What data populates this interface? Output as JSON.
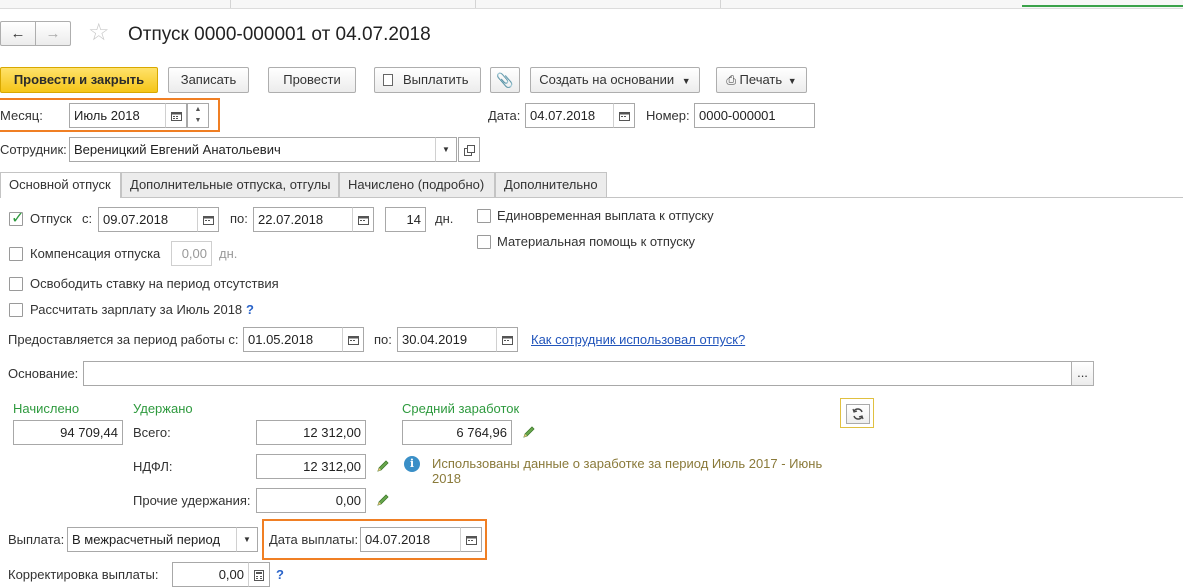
{
  "window": {
    "title": "Отпуск 0000-000001 от 04.07.2018"
  },
  "toolbar": {
    "post_and_close": "Провести и закрыть",
    "save": "Записать",
    "post": "Провести",
    "pay": "Выплатить",
    "create_based_on": "Создать на основании",
    "print": "Печать"
  },
  "header": {
    "month_label": "Месяц:",
    "month_value": "Июль 2018",
    "date_label": "Дата:",
    "date_value": "04.07.2018",
    "number_label": "Номер:",
    "number_value": "0000-000001",
    "employee_label": "Сотрудник:",
    "employee_value": "Вереницкий Евгений Анатольевич"
  },
  "tabs": [
    {
      "label": "Основной отпуск",
      "active": true
    },
    {
      "label": "Дополнительные отпуска, отгулы",
      "active": false
    },
    {
      "label": "Начислено (подробно)",
      "active": false
    },
    {
      "label": "Дополнительно",
      "active": false
    }
  ],
  "vacation": {
    "label": "Отпуск",
    "checked": true,
    "from_label": "с:",
    "from_value": "09.07.2018",
    "to_label": "по:",
    "to_value": "22.07.2018",
    "days_value": "14",
    "days_label": "дн.",
    "compensation_label": "Компенсация отпуска",
    "compensation_value": "0,00",
    "compensation_days_label": "дн.",
    "free_rate_label": "Освободить ставку на период отсутствия",
    "calc_salary_label": "Рассчитать зарплату за Июль 2018",
    "help_mark": "?",
    "lump_sum_label": "Единовременная выплата к отпуску",
    "material_aid_label": "Материальная помощь к отпуску"
  },
  "work_period": {
    "label": "Предоставляется за период работы с:",
    "from_value": "01.05.2018",
    "to_label": "по:",
    "to_value": "30.04.2019",
    "link": "Как сотрудник использовал отпуск?"
  },
  "basis": {
    "label": "Основание:",
    "value": "",
    "dots": "..."
  },
  "totals": {
    "accrued_label": "Начислено",
    "accrued_value": "94 709,44",
    "withheld_label": "Удержано",
    "total_label": "Всего:",
    "total_value": "12 312,00",
    "ndfl_label": "НДФЛ:",
    "ndfl_value": "12 312,00",
    "other_label": "Прочие удержания:",
    "other_value": "0,00",
    "avg_label": "Средний заработок",
    "avg_value": "6 764,96",
    "info_text_1": "Использованы данные о заработке за период Июль 2017 - Июнь",
    "info_text_2": "2018"
  },
  "payment": {
    "label": "Выплата:",
    "value": "В межрасчетный период",
    "date_label": "Дата выплаты:",
    "date_value": "04.07.2018",
    "correction_label": "Корректировка выплаты:",
    "correction_value": "0,00",
    "help_mark": "?"
  },
  "colors": {
    "primary_button": "#f5c518",
    "highlight": "#f07f24",
    "green_label": "#2e9a3e",
    "link": "#2255bb"
  }
}
